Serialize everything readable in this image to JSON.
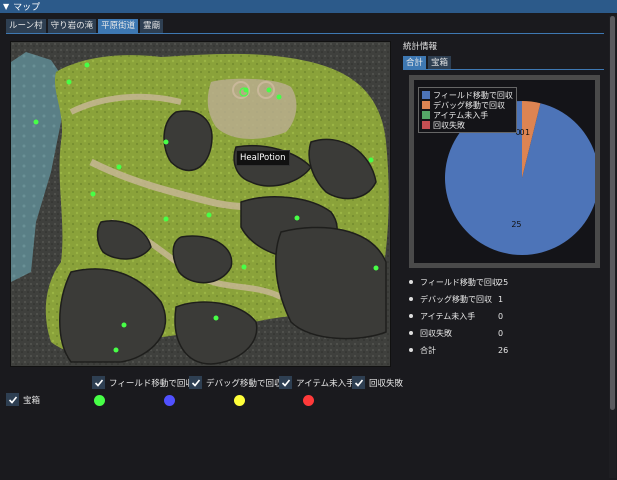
{
  "window": {
    "title": "マップ"
  },
  "tabs": [
    {
      "label": "ルーン村",
      "active": false
    },
    {
      "label": "守り岩の滝",
      "active": false
    },
    {
      "label": "平原街道",
      "active": true
    },
    {
      "label": "霊廟",
      "active": false
    }
  ],
  "map": {
    "tooltip": "HealPotion",
    "image": "field-map-terrain"
  },
  "filters": [
    {
      "label": "フィールド移動で回収",
      "checked": true
    },
    {
      "label": "デバッグ移動で回収",
      "checked": true
    },
    {
      "label": "アイテム未入手",
      "checked": true
    },
    {
      "label": "回収失敗",
      "checked": true
    },
    {
      "label": "宝箱",
      "checked": true
    }
  ],
  "colors": {
    "field": "#47ff47",
    "debug": "#5050ff",
    "missing": "#ffff3a",
    "failed": "#ff3a3a",
    "accent": "#3e78b2",
    "pie_field": "#4d74b8",
    "pie_debug": "#dd8452",
    "pie_missing": "#55a868",
    "pie_failed": "#c44e52"
  },
  "stats": {
    "title": "統計情報",
    "tabs": [
      {
        "label": "合計",
        "active": true
      },
      {
        "label": "宝箱",
        "active": false
      }
    ],
    "rows": [
      {
        "label": "フィールド移動で回収",
        "value": "25"
      },
      {
        "label": "デバッグ移動で回収",
        "value": "1"
      },
      {
        "label": "アイテム未入手",
        "value": "0"
      },
      {
        "label": "回収失敗",
        "value": "0"
      },
      {
        "label": "合計",
        "value": "26"
      }
    ]
  },
  "chart_data": {
    "type": "pie",
    "labels": [
      "フィールド移動で回収",
      "デバッグ移動で回収",
      "アイテム未入手",
      "回収失敗"
    ],
    "values": [
      25,
      1,
      0,
      0
    ],
    "data_labels": [
      "25",
      "1",
      "0",
      "0"
    ],
    "colors": [
      "#4d74b8",
      "#dd8452",
      "#55a868",
      "#c44e52"
    ],
    "legend_position": "top-left"
  }
}
